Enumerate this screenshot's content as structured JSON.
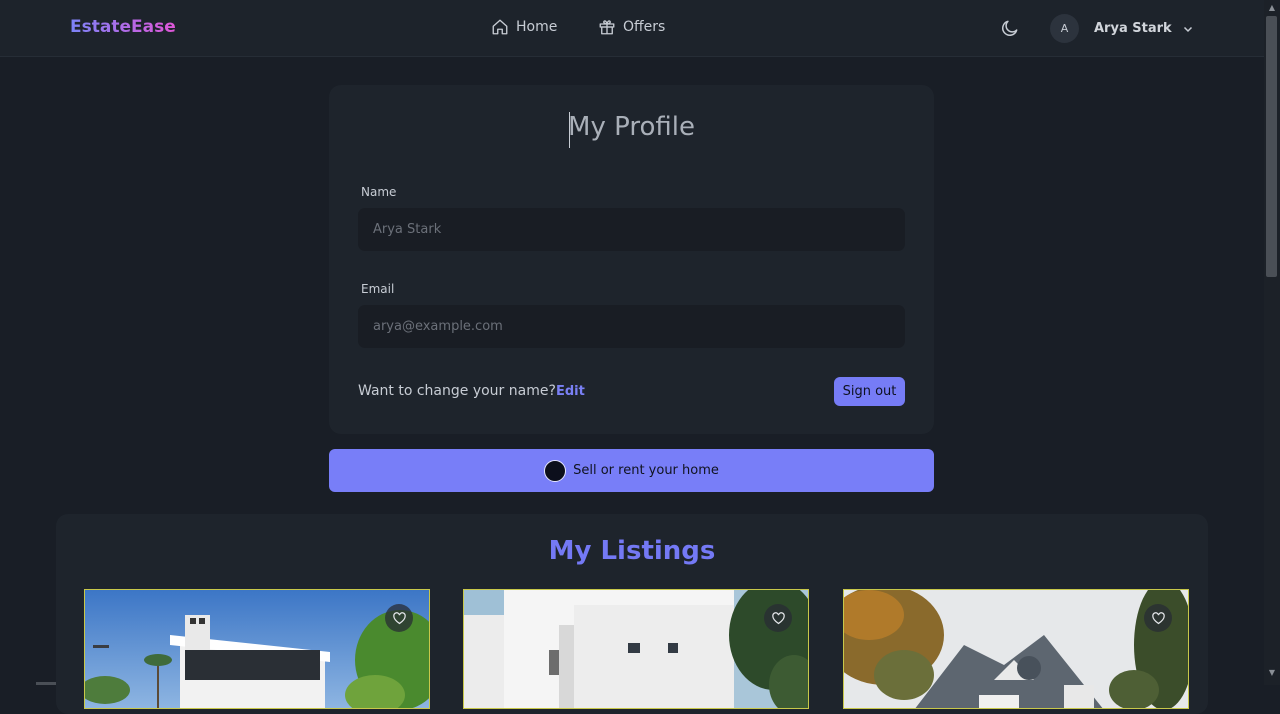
{
  "navbar": {
    "brand": "EstateEase",
    "links": [
      {
        "label": "Home",
        "icon": "home-icon"
      },
      {
        "label": "Offers",
        "icon": "gift-icon"
      }
    ],
    "theme_icon": "moon-icon",
    "user": {
      "initial": "A",
      "name": "Arya Stark"
    }
  },
  "profile": {
    "title": "My Profile",
    "name_label": "Name",
    "name_placeholder": "Arya Stark",
    "email_label": "Email",
    "email_placeholder": "arya@example.com",
    "change_text": "Want to change your name?",
    "edit_label": "Edit",
    "signout_label": "Sign out"
  },
  "sell_button": {
    "label": "Sell or rent your home"
  },
  "listings": {
    "title": "My Listings",
    "cards": [
      {
        "image": "modern-white-villa",
        "favorite_icon": "heart-icon"
      },
      {
        "image": "white-cubic-house",
        "favorite_icon": "heart-icon"
      },
      {
        "image": "grey-shingle-house",
        "favorite_icon": "heart-icon"
      }
    ]
  },
  "colors": {
    "accent": "#787ef8",
    "background": "#191e26",
    "card": "#1e242c"
  }
}
